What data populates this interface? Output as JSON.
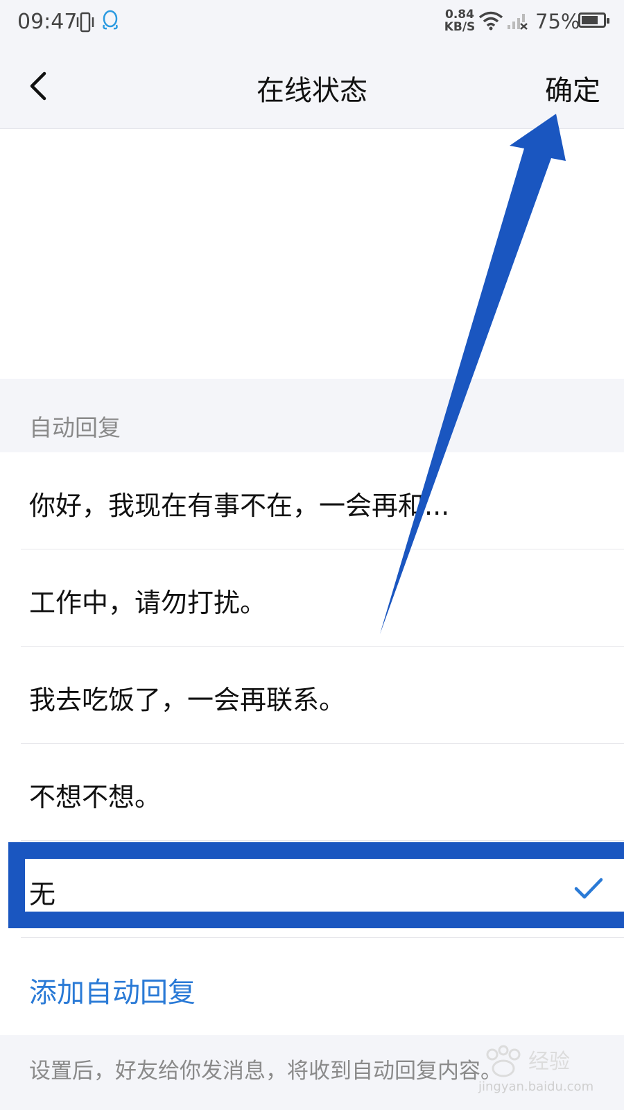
{
  "status_bar": {
    "time": "09:47",
    "net_speed_value": "0.84",
    "net_speed_unit": "KB/S",
    "battery": "75%",
    "battery_level": 0.75
  },
  "nav": {
    "title": "在线状态",
    "confirm_label": "确定"
  },
  "section": {
    "label": "自动回复"
  },
  "replies": [
    {
      "text": "你好，我现在有事不在，一会再和..."
    },
    {
      "text": "工作中，请勿打扰。"
    },
    {
      "text": "我去吃饭了，一会再联系。"
    },
    {
      "text": "不想不想。"
    },
    {
      "text": "无",
      "selected": true
    }
  ],
  "add_label": "添加自动回复",
  "footer_note": "设置后，好友给你发消息，将收到自动回复内容。",
  "watermark": {
    "brand": "Baidu 经验",
    "url": "jingyan.baidu.com"
  },
  "colors": {
    "accent": "#2a7ad6",
    "annotation": "#1a56c0"
  }
}
